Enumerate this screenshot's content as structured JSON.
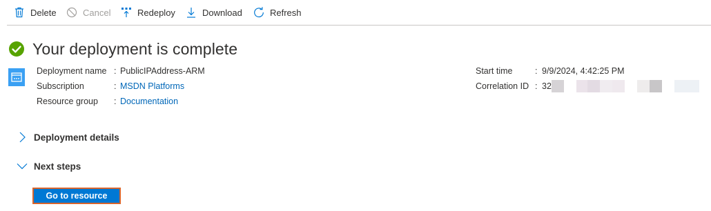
{
  "toolbar": {
    "delete_label": "Delete",
    "cancel_label": "Cancel",
    "redeploy_label": "Redeploy",
    "download_label": "Download",
    "refresh_label": "Refresh"
  },
  "header": {
    "title": "Your deployment is complete"
  },
  "details": {
    "deployment_name_label": "Deployment name",
    "deployment_name_value": "PublicIPAddress-ARM",
    "subscription_label": "Subscription",
    "subscription_value": "MSDN Platforms",
    "resource_group_label": "Resource group",
    "resource_group_value": "Documentation",
    "start_time_label": "Start time",
    "start_time_value": "9/9/2024, 4:42:25 PM",
    "correlation_id_label": "Correlation ID",
    "correlation_id_value": "32",
    "separator": ":"
  },
  "sections": {
    "deployment_details_label": "Deployment details",
    "next_steps_label": "Next steps"
  },
  "actions": {
    "go_to_resource_label": "Go to resource"
  },
  "colors": {
    "accent": "#0078d4",
    "link": "#0067b8",
    "success": "#57a300",
    "focus_outline": "#d9642b",
    "disabled_text": "#a19f9d"
  },
  "icons": {
    "delete": "trash-icon",
    "cancel": "cancel-icon",
    "redeploy": "redeploy-icon",
    "download": "download-icon",
    "refresh": "refresh-icon",
    "status": "success-check-icon",
    "resource": "deployment-resource-icon",
    "collapsed": "chevron-right-icon",
    "expanded": "chevron-down-icon"
  }
}
